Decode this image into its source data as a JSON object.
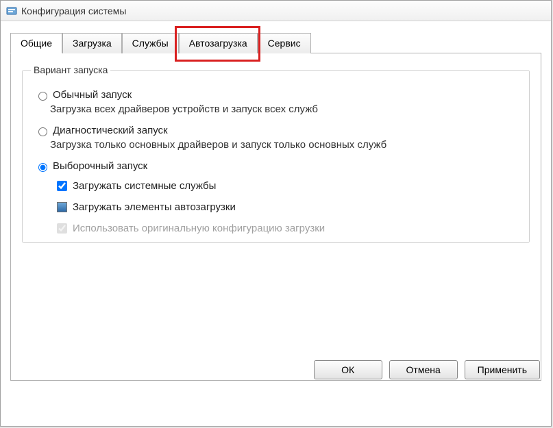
{
  "window": {
    "title": "Конфигурация системы"
  },
  "tabs": {
    "general": "Общие",
    "boot": "Загрузка",
    "services": "Службы",
    "startup": "Автозагрузка",
    "tools": "Сервис"
  },
  "group": {
    "legend": "Вариант запуска",
    "normal": {
      "label": "Обычный запуск",
      "desc": "Загрузка всех драйверов устройств и запуск всех служб"
    },
    "diagnostic": {
      "label": "Диагностический запуск",
      "desc": "Загрузка только основных драйверов и запуск только основных служб"
    },
    "selective": {
      "label": "Выборочный запуск",
      "load_services": "Загружать системные службы",
      "load_startup": "Загружать элементы автозагрузки",
      "use_original": "Использовать оригинальную конфигурацию загрузки"
    }
  },
  "buttons": {
    "ok": "ОК",
    "cancel": "Отмена",
    "apply": "Применить"
  }
}
